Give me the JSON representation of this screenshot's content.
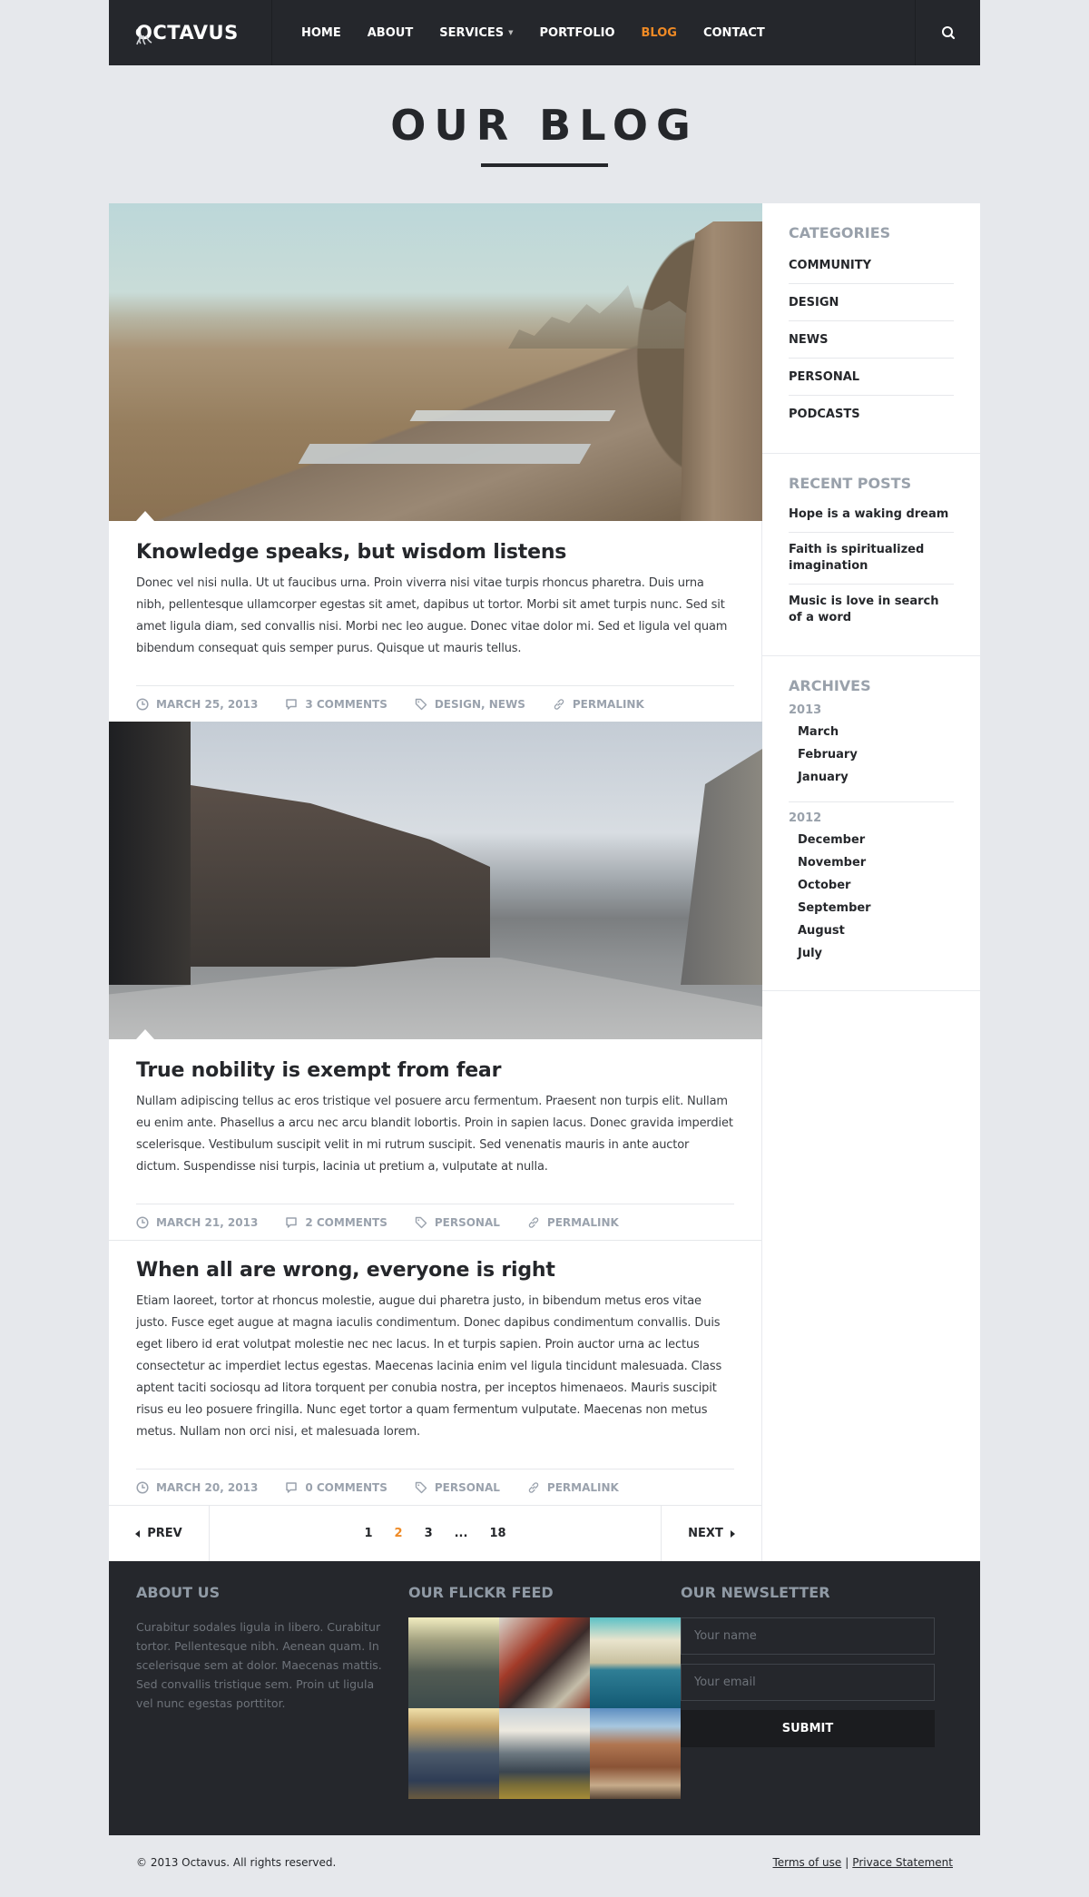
{
  "header": {
    "logo": "OCTAVUS",
    "nav": [
      {
        "label": "HOME",
        "active": false
      },
      {
        "label": "ABOUT",
        "active": false
      },
      {
        "label": "SERVICES",
        "active": false,
        "dropdown": true
      },
      {
        "label": "PORTFOLIO",
        "active": false
      },
      {
        "label": "BLOG",
        "active": true
      },
      {
        "label": "CONTACT",
        "active": false
      }
    ],
    "search_icon": "search-icon"
  },
  "page": {
    "title": "OUR BLOG"
  },
  "posts": [
    {
      "title": "Knowledge speaks, but wisdom listens",
      "text": "Donec vel nisi nulla. Ut ut faucibus urna. Proin viverra nisi vitae turpis rhoncus pharetra. Duis urna nibh, pellentesque ullamcorper egestas sit amet, dapibus ut tortor. Morbi sit amet turpis nunc. Sed sit amet ligula diam, sed convallis nisi. Morbi nec leo augue. Donec vitae dolor mi. Sed et ligula vel quam bibendum consequat quis semper purus. Quisque ut mauris tellus.",
      "date": "MARCH 25, 2013",
      "comments": "3 COMMENTS",
      "tags": "DESIGN, NEWS",
      "permalink": "PERMALINK",
      "has_image": true
    },
    {
      "title": "True nobility is exempt from fear",
      "text": "Nullam adipiscing tellus ac eros tristique vel posuere arcu fermentum. Praesent non turpis elit. Nullam eu enim ante. Phasellus a arcu nec arcu blandit lobortis. Proin in sapien lacus. Donec gravida imperdiet scelerisque. Vestibulum suscipit velit in mi rutrum suscipit. Sed venenatis mauris in ante auctor dictum. Suspendisse nisi turpis, lacinia ut pretium a, vulputate at nulla.",
      "date": "MARCH 21, 2013",
      "comments": "2 COMMENTS",
      "tags": "PERSONAL",
      "permalink": "PERMALINK",
      "has_image": true
    },
    {
      "title": "When all are wrong, everyone is right",
      "text": "Etiam laoreet, tortor at rhoncus molestie, augue dui pharetra justo, in bibendum metus eros vitae justo. Fusce eget augue at magna iaculis condimentum. Donec dapibus condimentum convallis. Duis eget libero id erat volutpat molestie nec nec lacus. In et turpis sapien. Proin auctor urna ac lectus consectetur ac imperdiet lectus egestas. Maecenas lacinia enim vel ligula tincidunt malesuada. Class aptent taciti sociosqu ad litora torquent per conubia nostra, per inceptos himenaeos. Mauris suscipit risus eu leo posuere fringilla. Nunc eget tortor a quam fermentum vulputate. Maecenas non metus metus. Nullam non orci nisi, et malesuada lorem.",
      "date": "MARCH 20, 2013",
      "comments": "0 COMMENTS",
      "tags": "PERSONAL",
      "permalink": "PERMALINK",
      "has_image": false
    }
  ],
  "pagination": {
    "prev": "PREV",
    "next": "NEXT",
    "pages": [
      "1",
      "2",
      "3",
      "...",
      "18"
    ],
    "current": "2"
  },
  "sidebar": {
    "categories": {
      "title": "CATEGORIES",
      "items": [
        "COMMUNITY",
        "DESIGN",
        "NEWS",
        "PERSONAL",
        "PODCASTS"
      ]
    },
    "recent": {
      "title": "RECENT POSTS",
      "items": [
        "Hope is a waking dream",
        "Faith is spiritualized imagination",
        "Music is love in search of a word"
      ]
    },
    "archives": {
      "title": "ARCHIVES",
      "years": [
        {
          "year": "2013",
          "months": [
            "March",
            "February",
            "January"
          ]
        },
        {
          "year": "2012",
          "months": [
            "December",
            "November",
            "October",
            "September",
            "August",
            "July"
          ]
        }
      ]
    }
  },
  "footer": {
    "about": {
      "title": "ABOUT US",
      "text": "Curabitur sodales ligula in libero. Curabitur tortor. Pellentesque nibh. Aenean quam. In scelerisque sem at dolor. Maecenas mattis. Sed convallis tristique sem. Proin ut ligula vel nunc egestas porttitor."
    },
    "flickr": {
      "title": "OUR FLICKR FEED",
      "count": 6
    },
    "newsletter": {
      "title": "OUR NEWSLETTER",
      "name_placeholder": "Your name",
      "email_placeholder": "Your email",
      "submit": "SUBMIT"
    }
  },
  "bottom": {
    "copyright": "© 2013 Octavus. All rights reserved.",
    "terms": "Terms of use",
    "separator": "|",
    "privacy": "Privace Statement"
  },
  "colors": {
    "accent": "#ef8a25",
    "dark": "#25272c",
    "muted": "#99a1ab"
  }
}
